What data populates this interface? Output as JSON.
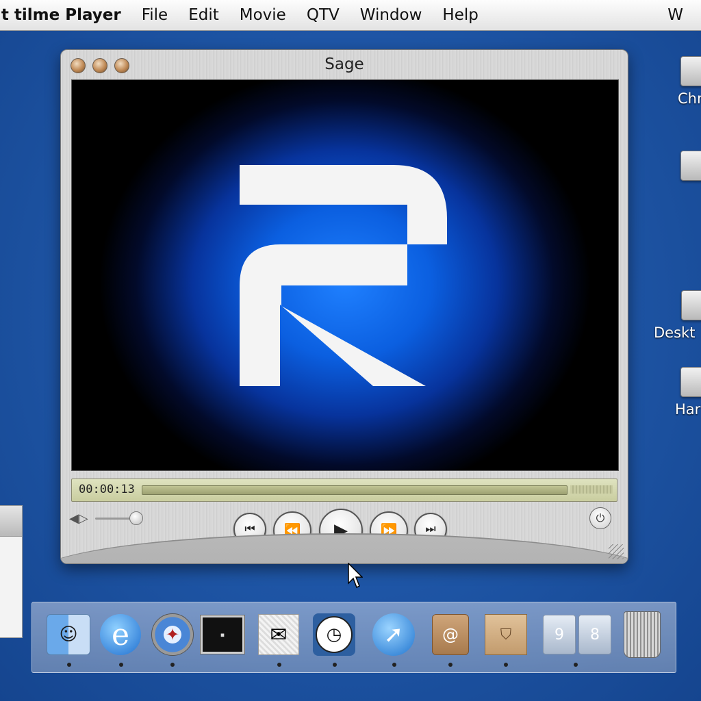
{
  "menubar": {
    "app": "it tilme Player",
    "items": [
      "File",
      "Edit",
      "Movie",
      "QTV",
      "Window",
      "Help"
    ],
    "right": "W"
  },
  "desktop": {
    "icons": [
      {
        "label": "Chr"
      },
      {
        "label": ""
      },
      {
        "label": "Deskt"
      },
      {
        "label": "Har"
      }
    ]
  },
  "player": {
    "title": "Sage",
    "timecode": "00:00:13",
    "progress": 0.0,
    "volume_level": 0.85,
    "controls": {
      "prev": "⏮",
      "rewind": "⏪",
      "play": "▶",
      "forward": "⏩",
      "next": "⏭"
    },
    "power": "⏻"
  },
  "dock": {
    "items": [
      {
        "name": "finder",
        "glyph": "☺"
      },
      {
        "name": "internet-explorer",
        "glyph": "e"
      },
      {
        "name": "safari",
        "glyph": "✦"
      },
      {
        "name": "terminal",
        "glyph": "▪"
      },
      {
        "name": "mail",
        "glyph": "✉"
      },
      {
        "name": "clock",
        "glyph": "◷"
      },
      {
        "name": "arrow-app",
        "glyph": "➚"
      },
      {
        "name": "bag-app",
        "glyph": "@"
      },
      {
        "name": "shopping-bag",
        "glyph": "⛉"
      },
      {
        "name": "folders",
        "glyph1": "9",
        "glyph2": "8"
      },
      {
        "name": "trash",
        "glyph": ""
      }
    ]
  }
}
